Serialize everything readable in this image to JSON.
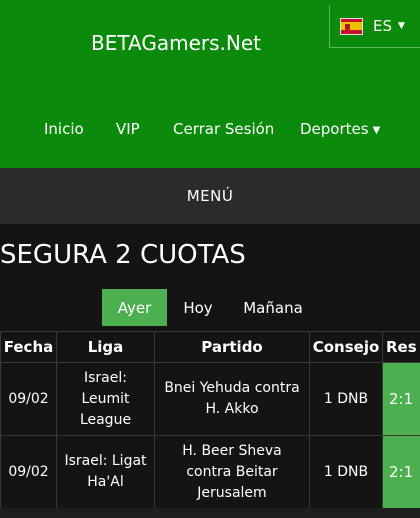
{
  "header": {
    "brand": "BETAGamers.Net",
    "language": {
      "code": "ES",
      "flag_icon": "spain-flag-icon"
    },
    "nav": [
      {
        "label": "Inicio"
      },
      {
        "label": "VIP"
      },
      {
        "label": "Cerrar Sesión"
      },
      {
        "label": "Deportes",
        "has_dropdown": true
      }
    ]
  },
  "menubar": {
    "label": "MENÚ"
  },
  "main": {
    "title": "SEGURA 2 CUOTAS",
    "tabs": [
      {
        "label": "Ayer",
        "active": true
      },
      {
        "label": "Hoy",
        "active": false
      },
      {
        "label": "Mañana",
        "active": false
      }
    ],
    "table": {
      "headers": [
        "Fecha",
        "Liga",
        "Partido",
        "Consejo",
        "Res"
      ],
      "rows": [
        {
          "fecha": "09/02",
          "liga": "Israel: Leumit League",
          "partido": "Bnei Yehuda contra H. Akko",
          "consejo": "1 DNB",
          "res": "2:1"
        },
        {
          "fecha": "09/02",
          "liga": "Israel: Ligat Ha'Al",
          "partido": "H. Beer Sheva contra Beitar Jerusalem",
          "consejo": "1 DNB",
          "res": "2:1"
        }
      ]
    }
  },
  "colors": {
    "header_green": "#0b8a0b",
    "accent_green": "#4caf50",
    "menubar": "#2b2b2b",
    "background": "#141414"
  }
}
